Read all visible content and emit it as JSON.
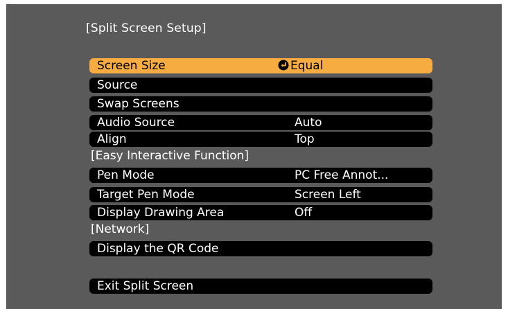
{
  "title": "[Split Screen Setup]",
  "menu": {
    "screen_size": {
      "label": "Screen Size",
      "value": "Equal"
    },
    "source": {
      "label": "Source"
    },
    "swap_screens": {
      "label": "Swap Screens"
    },
    "audio_source": {
      "label": "Audio Source",
      "value": "Auto"
    },
    "align": {
      "label": "Align",
      "value": "Top"
    },
    "easy_interactive_header": "[Easy Interactive Function]",
    "pen_mode": {
      "label": "Pen Mode",
      "value": "PC Free Annot..."
    },
    "target_pen_mode": {
      "label": "Target Pen Mode",
      "value": "Screen Left"
    },
    "display_drawing_area": {
      "label": "Display Drawing Area",
      "value": "Off"
    },
    "network_header": "[Network]",
    "display_qr_code": {
      "label": "Display the QR Code"
    },
    "exit_split_screen": {
      "label": "Exit Split Screen"
    }
  },
  "colors": {
    "panel_background": "#5a5a5a",
    "row_background": "#000000",
    "selected_row": "#f6ac41",
    "text": "#ffffff"
  },
  "icons": {
    "selected_value_icon": "enter-arrow-icon"
  }
}
